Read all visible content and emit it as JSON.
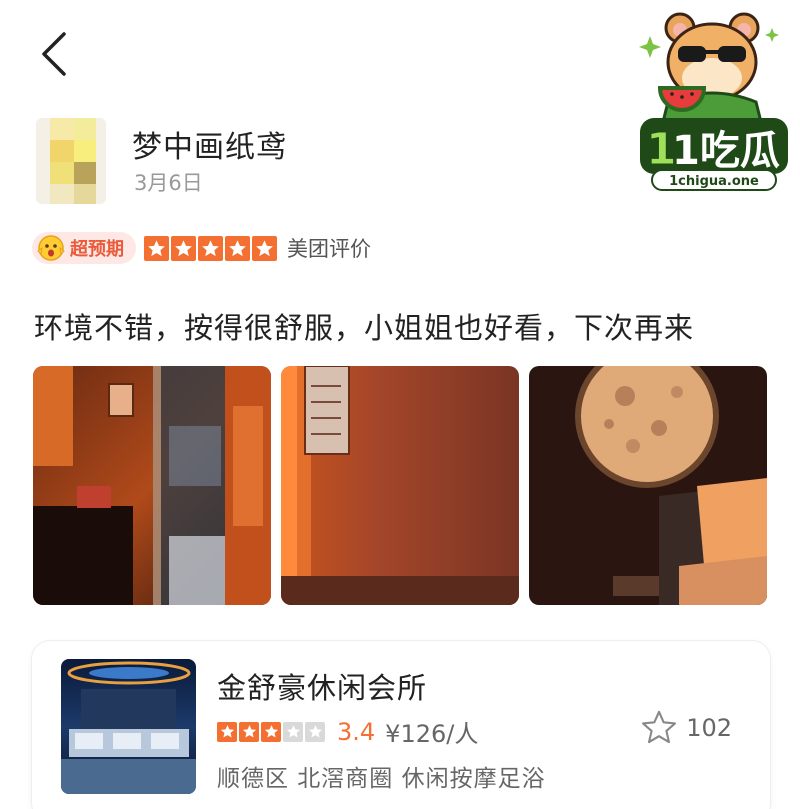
{
  "user": {
    "name": "梦中画纸鸢",
    "date": "3月6日"
  },
  "logo": {
    "name": "1吃瓜",
    "domain": "1chigua.one"
  },
  "review": {
    "badge": "超预期",
    "stars": 5,
    "source": "美团评价",
    "text": "环境不错，按得很舒服，小姐姐也好看，下次再来"
  },
  "shop": {
    "name": "金舒豪休闲会所",
    "stars": 3,
    "score": "3.4",
    "price": "¥126/人",
    "favorites": "102",
    "meta": "顺德区 北滘商圈 休闲按摩足浴"
  },
  "colors": {
    "accent": "#f46f32",
    "badge_bg": "#fde8e6",
    "badge_text": "#ea5b3c"
  },
  "icons": [
    "back-arrow-icon",
    "surprised-face-icon",
    "star-icon",
    "star-outline-icon"
  ]
}
